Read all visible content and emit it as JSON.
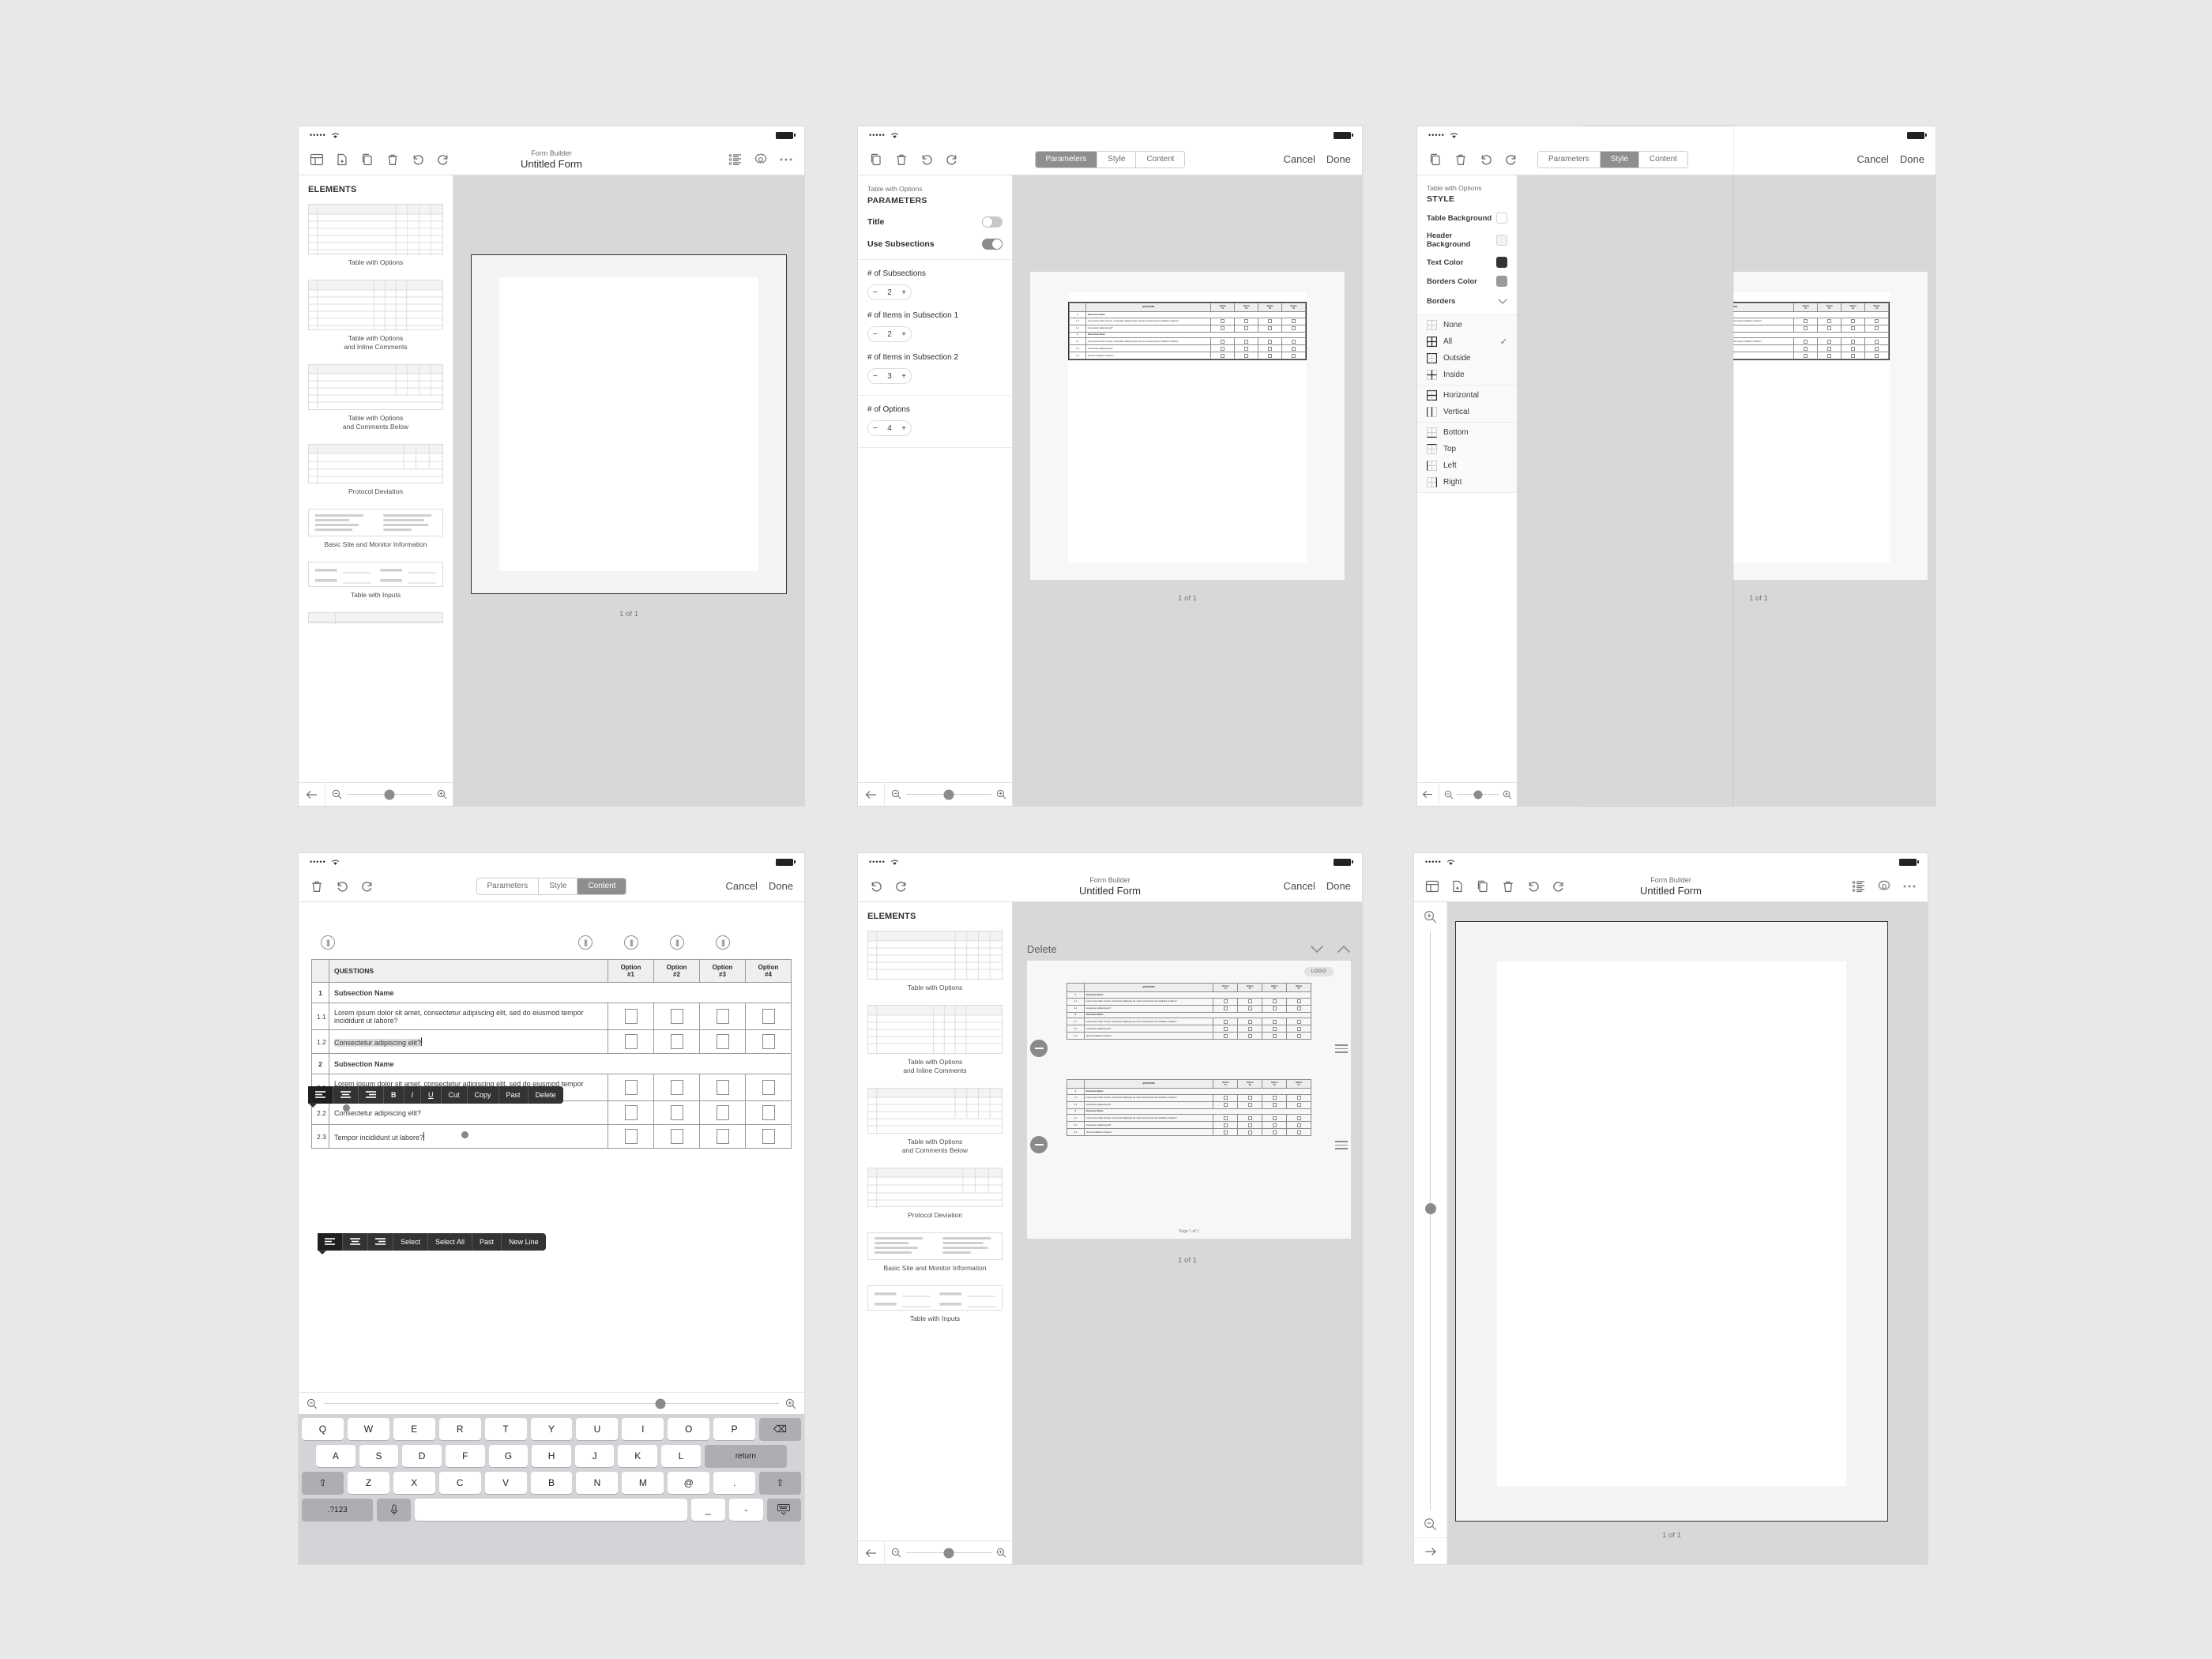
{
  "app": {
    "title_small": "Form Builder",
    "title_main": "Untitled Form"
  },
  "status_bar": {
    "signal": "•••••",
    "wifi": "▲"
  },
  "segmented": {
    "parameters": "Parameters",
    "style": "Style",
    "content": "Content"
  },
  "actions": {
    "cancel": "Cancel",
    "done": "Done"
  },
  "sidebar": {
    "title": "ELEMENTS",
    "items": [
      {
        "label": "Table with Options",
        "type": "grid"
      },
      {
        "label": "Table with Options\nand Inline Comments",
        "type": "grid"
      },
      {
        "label": "Table with Options\nand Comments Below",
        "type": "grid"
      },
      {
        "label": "Protocol Deviation",
        "type": "grid"
      },
      {
        "label": "Basic Site and Monitor Information",
        "type": "lines"
      },
      {
        "label": "Table with Inputs",
        "type": "inputs"
      }
    ],
    "captions": {
      "c0": "Table with Options",
      "c1a": "Table with Options",
      "c1b": "and Inline Comments",
      "c2a": "Table with Options",
      "c2b": "and Comments Below",
      "c3": "Protocol Deviation",
      "c4": "Basic Site and Monitor Information",
      "c5": "Table with Inputs"
    }
  },
  "parameters_panel": {
    "subtitle": "Table with Options",
    "heading": "PARAMETERS",
    "title_label": "Title",
    "title_on": false,
    "use_subsections_label": "Use Subsections",
    "use_subsections_on": true,
    "fields": [
      {
        "label": "# of Subsections",
        "value": "2"
      },
      {
        "label": "# of Items in Subsection 1",
        "value": "2"
      },
      {
        "label": "# of Items in Subsection 2",
        "value": "3"
      },
      {
        "label": "# of Options",
        "value": "4"
      }
    ],
    "minus": "−",
    "plus": "+"
  },
  "style_panel": {
    "subtitle": "Table with Options",
    "heading": "STYLE",
    "rows": [
      {
        "label": "Table Background",
        "color": "#ffffff"
      },
      {
        "label": "Header Background",
        "color": "#f2f2f2"
      },
      {
        "label": "Text Color",
        "color": "#333333"
      },
      {
        "label": "Borders Color",
        "color": "#9a9a9a"
      }
    ],
    "borders_label": "Borders",
    "border_options": [
      {
        "label": "None",
        "selected": false
      },
      {
        "label": "All",
        "selected": true
      },
      {
        "label": "Outside",
        "selected": false
      },
      {
        "label": "Inside",
        "selected": false
      },
      {
        "label": "Horizontal",
        "selected": false
      },
      {
        "label": "Vertical",
        "selected": false
      },
      {
        "label": "Bottom",
        "selected": false
      },
      {
        "label": "Top",
        "selected": false
      },
      {
        "label": "Left",
        "selected": false
      },
      {
        "label": "Right",
        "selected": false
      }
    ],
    "check": "✓"
  },
  "table": {
    "header_questions": "QUESTIONS",
    "options": [
      "Option\n#1",
      "Option\n#2",
      "Option\n#3",
      "Option\n#4"
    ],
    "option_labels": [
      {
        "l1": "Option",
        "l2": "#1"
      },
      {
        "l1": "Option",
        "l2": "#2"
      },
      {
        "l1": "Option",
        "l2": "#3"
      },
      {
        "l1": "Option",
        "l2": "#4"
      }
    ],
    "rows": [
      {
        "num": "1",
        "text": "Subsection Name",
        "section": true
      },
      {
        "num": "1.1",
        "text": "Lorem ipsum dolor sit amet, consectetur adipiscing elit, sed do eiusmod tempor incididunt ut labore?",
        "section": false
      },
      {
        "num": "1.2",
        "text": "Consectetur adipiscing elit?",
        "section": false
      },
      {
        "num": "2",
        "text": "Subsection Name",
        "section": true
      },
      {
        "num": "2.1",
        "text": "Lorem ipsum dolor sit amet, consectetur adipiscing elit, sed do eiusmod tempor incididunt ut labore?",
        "section": false
      },
      {
        "num": "2.2",
        "text": "Consectetur adipiscing elit?",
        "section": false
      },
      {
        "num": "2.3",
        "text": "Tempor incididunt ut labore?",
        "section": false
      }
    ]
  },
  "content_view": {
    "ctx_format": {
      "b": "B",
      "i": "I",
      "u": "U",
      "cut": "Cut",
      "copy": "Copy",
      "paste": "Past",
      "delete": "Delete"
    },
    "ctx_select": {
      "select": "Select",
      "select_all": "Select All",
      "paste": "Past",
      "new_line": "New Line"
    },
    "editing_row_text": "Consectetur adipiscing elit?",
    "caret_row_text": "Tempor incididunt ut labore?"
  },
  "keyboard": {
    "row1": [
      "Q",
      "W",
      "E",
      "R",
      "T",
      "Y",
      "U",
      "I",
      "O",
      "P"
    ],
    "row2": [
      "A",
      "S",
      "D",
      "F",
      "G",
      "H",
      "J",
      "K",
      "L"
    ],
    "row3": [
      "Z",
      "X",
      "C",
      "V",
      "B",
      "N",
      "M",
      "@",
      "."
    ],
    "backspace": "⌫",
    "return": "return",
    "shift": "⇧",
    "numeric": ".?123",
    "mic": "ƨ",
    "underscore": "_",
    "hyphen": "-",
    "dismiss": "⌨"
  },
  "delete_view": {
    "delete_label": "Delete",
    "chevron_down": "⌄",
    "chevron_up": "⌃",
    "logo": "LOGO",
    "page_footer": "Page 1 of 1"
  },
  "footer": {
    "page_indicator": "1 of 1"
  },
  "icons": {
    "layout": "layout-icon",
    "new_page": "new-page-icon",
    "duplicate": "duplicate-icon",
    "trash": "trash-icon",
    "undo": "undo-icon",
    "redo": "redo-icon",
    "list": "list-icon",
    "gear": "gear-icon",
    "more": "more-icon",
    "zoom_out": "zoom-out-icon",
    "zoom_in": "zoom-in-icon",
    "back": "back-arrow-icon",
    "forward": "forward-arrow-icon",
    "chevron": "chevron-down-icon"
  },
  "colors": {
    "accent": "#8e8e8e",
    "canvas_bg": "#d8d8d8",
    "page_bg": "#f4f4f4",
    "body_bg": "#e8e8e8",
    "toolbar_dark": "#333333"
  }
}
